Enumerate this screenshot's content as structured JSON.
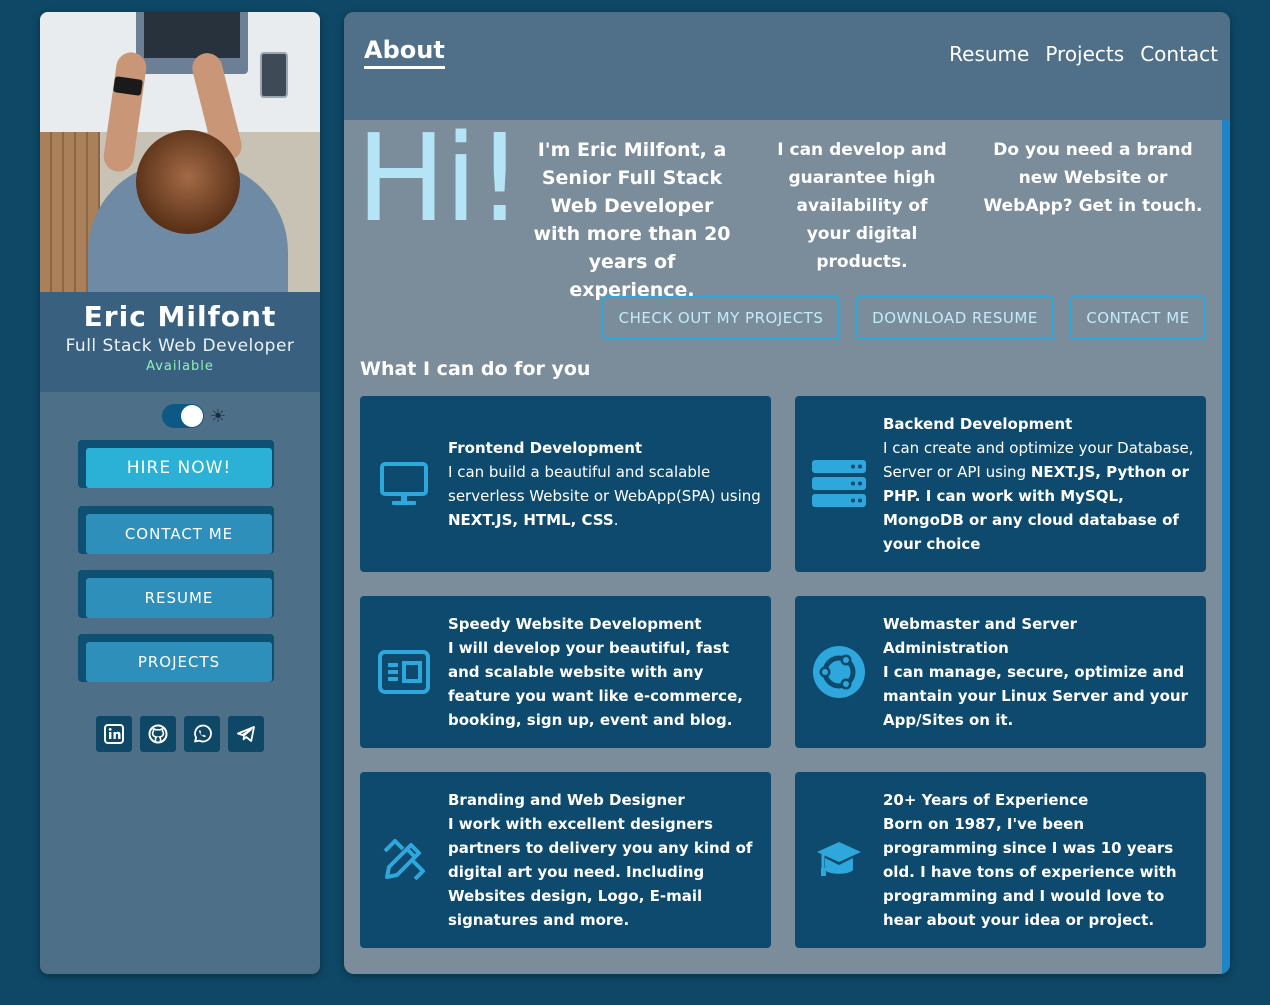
{
  "profile": {
    "name": "Eric Milfont",
    "role": "Full Stack Web Developer",
    "status": "Available"
  },
  "theme": {
    "icon": "sun-icon",
    "mode": "dark"
  },
  "sidebar_buttons": {
    "hire": "HIRE NOW!",
    "contact": "CONTACT ME",
    "resume": "RESUME",
    "projects": "PROJECTS"
  },
  "socials": [
    "linkedin-icon",
    "github-icon",
    "whatsapp-icon",
    "telegram-icon"
  ],
  "nav": {
    "active": "About",
    "links": [
      "Resume",
      "Projects",
      "Contact"
    ]
  },
  "hero": {
    "greeting": "Hi!",
    "intro1": "I'm Eric Milfont, a Senior Full Stack Web Developer with more than 20 years of experience.",
    "intro2": "I can develop and guarantee high availability of your digital products.",
    "intro3": "Do you need a brand new Website or WebApp? Get in touch."
  },
  "cta": {
    "projects": "CHECK OUT MY PROJECTS",
    "resume": "DOWNLOAD RESUME",
    "contact": "CONTACT ME"
  },
  "services_title": "What I can do for you",
  "services": [
    {
      "title": "Frontend Development",
      "text_pre": "I can build a beautiful and scalable serverless Website or WebApp(SPA) using ",
      "text_bold": "NEXT.JS, HTML, CSS",
      "text_post": ".",
      "icon": "monitor-icon"
    },
    {
      "title": "Backend Development",
      "text_pre": "I can create and optimize your Database, Server or API using ",
      "text_bold": "NEXT.JS, Python or PHP. I can work with MySQL, MongoDB or any cloud database of your choice",
      "text_post": "",
      "icon": "server-icon"
    },
    {
      "title": "Speedy Website Development",
      "text_pre": "",
      "text_bold": "I will develop your beautiful, fast and scalable website with any feature you want like e-commerce, booking, sign up, event and blog.",
      "text_post": "",
      "icon": "website-icon"
    },
    {
      "title": "Webmaster and Server Administration",
      "text_pre": "",
      "text_bold": "I can manage, secure, optimize and mantain your Linux Server and your App/Sites on it.",
      "text_post": "",
      "icon": "ubuntu-icon"
    },
    {
      "title": "Branding and Web Designer",
      "text_pre": "",
      "text_bold": "I work with excellent designers partners to delivery you any kind of digital art you need. Including Websites design, Logo, E-mail signatures and more.",
      "text_post": "",
      "icon": "design-tools-icon"
    },
    {
      "title": "20+ Years of Experience",
      "text_pre": "",
      "text_bold": "Born on 1987, I've been programming since I was 10 years old. I have tons of experience with programming and I would love to hear about your idea or project.",
      "text_post": "",
      "icon": "graduation-cap-icon"
    }
  ],
  "colors": {
    "background": "#0e4866",
    "accent": "#2ea8dc",
    "card": "#0d4a6d",
    "hi": "#b5e4f6",
    "available": "#8ff0b6"
  }
}
